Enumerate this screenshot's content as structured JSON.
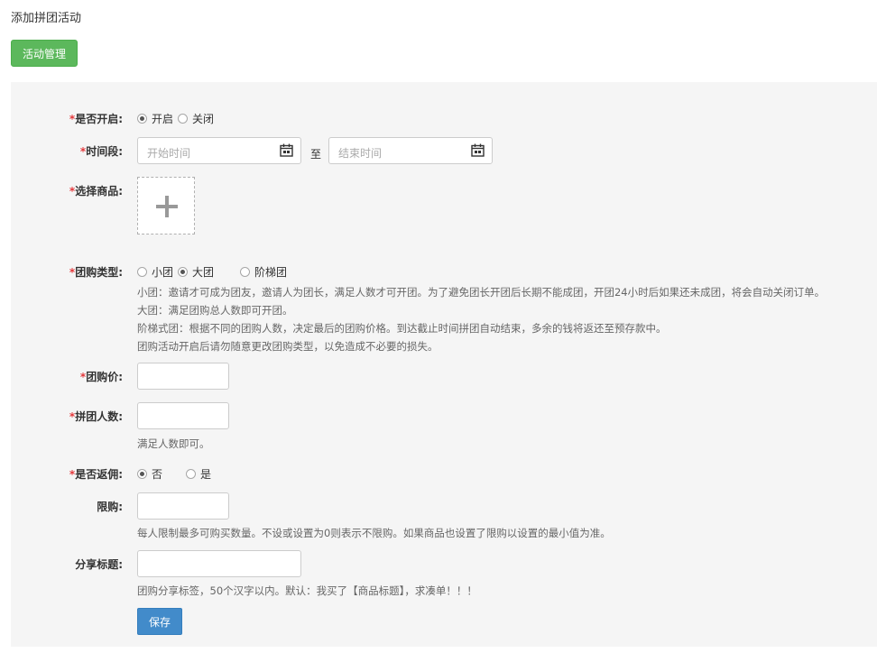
{
  "page": {
    "title": "添加拼团活动"
  },
  "header": {
    "manage_button": "活动管理"
  },
  "form": {
    "open": {
      "required": "*",
      "label": "是否开启:",
      "options": [
        "开启",
        "关闭"
      ],
      "selected": 0
    },
    "period": {
      "required": "*",
      "label": "时间段:",
      "start_placeholder": "开始时间",
      "end_placeholder": "结束时间",
      "separator": "至"
    },
    "product": {
      "required": "*",
      "label": "选择商品:"
    },
    "type": {
      "required": "*",
      "label": "团购类型:",
      "options": [
        "小团",
        "大团",
        "阶梯团"
      ],
      "selected": 1,
      "help": [
        "小团：邀请才可成为团友，邀请人为团长，满足人数才可开团。为了避免团长开团后长期不能成团，开团24小时后如果还未成团，将会自动关闭订单。",
        "大团：满足团购总人数即可开团。",
        "阶梯式团：根据不同的团购人数，决定最后的团购价格。到达截止时间拼团自动结束，多余的钱将返还至预存款中。",
        "团购活动开启后请勿随意更改团购类型，以免造成不必要的损失。"
      ]
    },
    "price": {
      "required": "*",
      "label": "团购价:",
      "value": ""
    },
    "group_size": {
      "required": "*",
      "label": "拼团人数:",
      "value": "",
      "help": "满足人数即可。"
    },
    "rebate": {
      "required": "*",
      "label": "是否返佣:",
      "options": [
        "否",
        "是"
      ],
      "selected": 0
    },
    "limit": {
      "label": "限购:",
      "value": "",
      "help": "每人限制最多可购买数量。不设或设置为0则表示不限购。如果商品也设置了限购以设置的最小值为准。"
    },
    "share_title": {
      "label": "分享标题:",
      "value": "",
      "help": "团购分享标签，50个汉字以内。默认：我买了【商品标题】，求凑单！！！"
    },
    "save_button": "保存"
  },
  "colors": {
    "green": "#5cb85c",
    "blue": "#428bca",
    "required": "#e4393c",
    "panel": "#f5f5f5"
  }
}
